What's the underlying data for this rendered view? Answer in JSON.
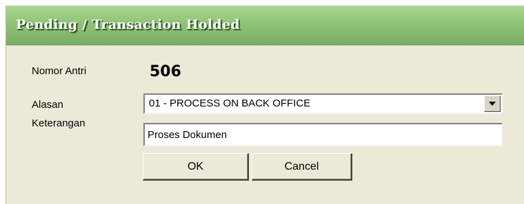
{
  "window": {
    "title": "Pending / Transaction Holded"
  },
  "form": {
    "queue_label": "Nomor Antri",
    "queue_value": "506",
    "reason_label": "Alasan",
    "reason_value": "01 - PROCESS ON BACK OFFICE",
    "note_label": "Keterangan",
    "note_value": "Proses Dokumen"
  },
  "buttons": {
    "ok_label": "OK",
    "cancel_label": "Cancel"
  },
  "icons": {
    "dropdown": "chevron-down-icon"
  },
  "colors": {
    "titlebar": "#8fc377",
    "dialog_bg": "#ece9d8"
  }
}
